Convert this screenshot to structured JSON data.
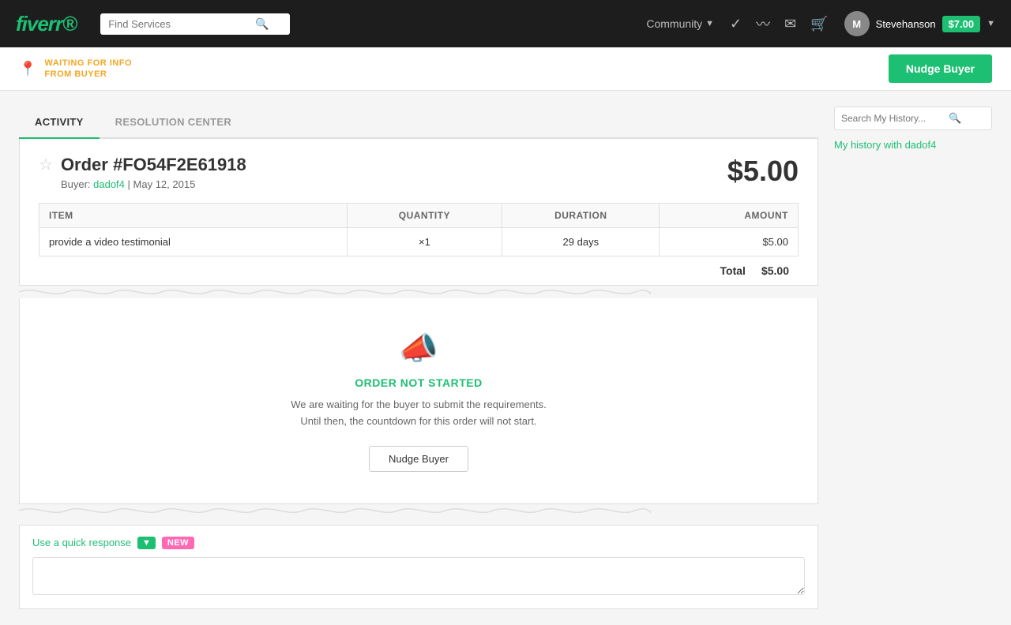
{
  "navbar": {
    "logo": "fiverr",
    "logo_dot": ".",
    "search_placeholder": "Find Services",
    "community_label": "Community",
    "username": "Stevehanson",
    "balance": "$7.00",
    "avatar_initial": "M"
  },
  "status_bar": {
    "waiting_line1": "WAITING FOR INFO",
    "waiting_line2": "FROM BUYER",
    "nudge_button": "Nudge Buyer"
  },
  "tabs": [
    {
      "label": "ACTIVITY",
      "active": true
    },
    {
      "label": "RESOLUTION CENTER",
      "active": false
    }
  ],
  "order": {
    "number": "Order #FO54F2E61918",
    "buyer_label": "Buyer:",
    "buyer_name": "dadof4",
    "date": "May 12, 2015",
    "price": "$5.00",
    "table": {
      "headers": [
        "ITEM",
        "QUANTITY",
        "DURATION",
        "AMOUNT"
      ],
      "rows": [
        {
          "item": "provide a video testimonial",
          "quantity": "×1",
          "duration": "29 days",
          "amount": "$5.00"
        }
      ],
      "total_label": "Total",
      "total_value": "$5.00"
    }
  },
  "order_status": {
    "title": "ORDER NOT STARTED",
    "description_line1": "We are waiting for the buyer to submit the requirements.",
    "description_line2": "Until then, the countdown for this order will not start.",
    "nudge_button": "Nudge Buyer"
  },
  "quick_response": {
    "label": "Use a quick response",
    "new_badge": "NEW",
    "input_placeholder": ""
  },
  "sidebar": {
    "search_placeholder": "Search My History...",
    "history_link": "My history with dadof4"
  }
}
